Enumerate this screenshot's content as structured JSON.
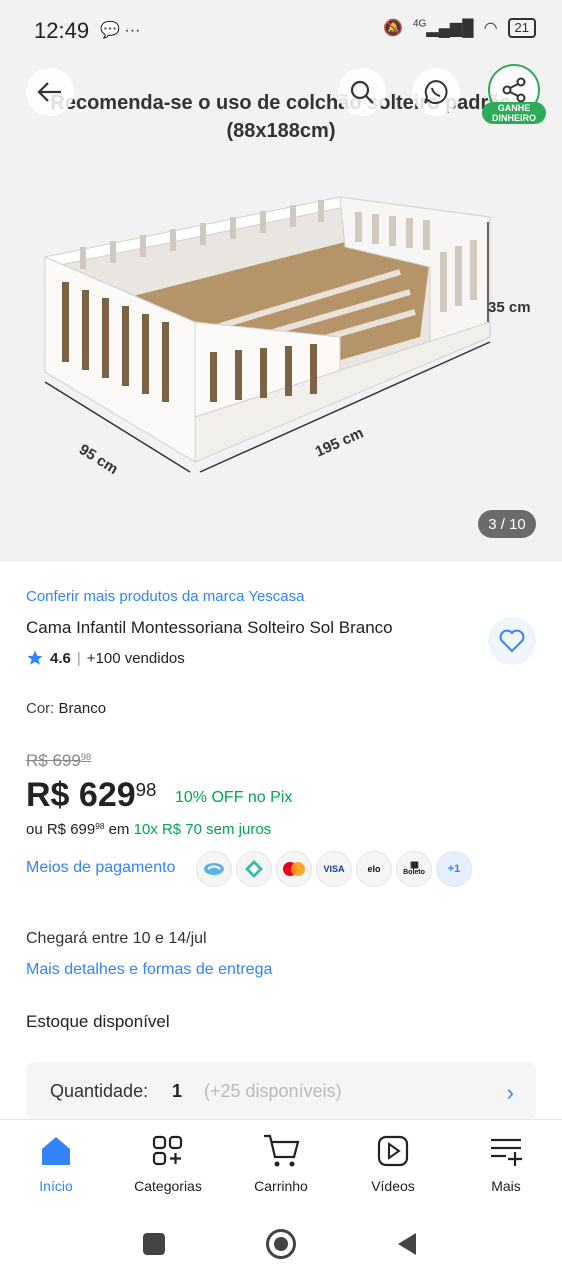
{
  "status_bar": {
    "time": "12:49",
    "signal": "4G",
    "battery": "21"
  },
  "gallery": {
    "caption_line1": "Recomenda-se o uso de colchão solteiro padrão",
    "caption_line2": "(88x188cm)",
    "dim_height": "35 cm",
    "dim_width": "95 cm",
    "dim_length": "195 cm",
    "counter": "3 / 10",
    "share_badge": "GANHE DINHEIRO"
  },
  "product": {
    "brand_link": "Conferir mais produtos da marca Yescasa",
    "title": "Cama Infantil Montessoriana Solteiro Sol Branco",
    "rating": "4.6",
    "sold": "+100 vendidos",
    "color_label": "Cor:",
    "color_value": "Branco"
  },
  "price": {
    "old_main": "R$ 699",
    "old_cents": "98",
    "main": "R$ 629",
    "cents": "98",
    "pix_discount": "10% OFF no Pix",
    "install_prefix": "ou R$ 699",
    "install_cents": "98",
    "install_mid": "em",
    "install_green": "10x R$ 70 sem juros",
    "payment_methods_label": "Meios de pagamento",
    "payment_icons": [
      "mercado-pago",
      "pix",
      "mastercard",
      "VISA",
      "elo",
      "Boleto"
    ],
    "payment_more": "+1"
  },
  "delivery": {
    "eta": "Chegará entre 10 e 14/jul",
    "details_link": "Mais detalhes e formas de entrega"
  },
  "stock": {
    "title": "Estoque disponível",
    "qty_label": "Quantidade:",
    "qty_value": "1",
    "available": "(+25 disponíveis)"
  },
  "nav": {
    "items": [
      {
        "label": "Início",
        "icon": "home-icon",
        "active": true
      },
      {
        "label": "Categorias",
        "icon": "categories-icon"
      },
      {
        "label": "Carrinho",
        "icon": "cart-icon"
      },
      {
        "label": "Vídeos",
        "icon": "video-icon"
      },
      {
        "label": "Mais",
        "icon": "menu-plus-icon"
      }
    ]
  },
  "colors": {
    "accent": "#3483fa",
    "green": "#00a650",
    "badge_green": "#2eab5a"
  }
}
